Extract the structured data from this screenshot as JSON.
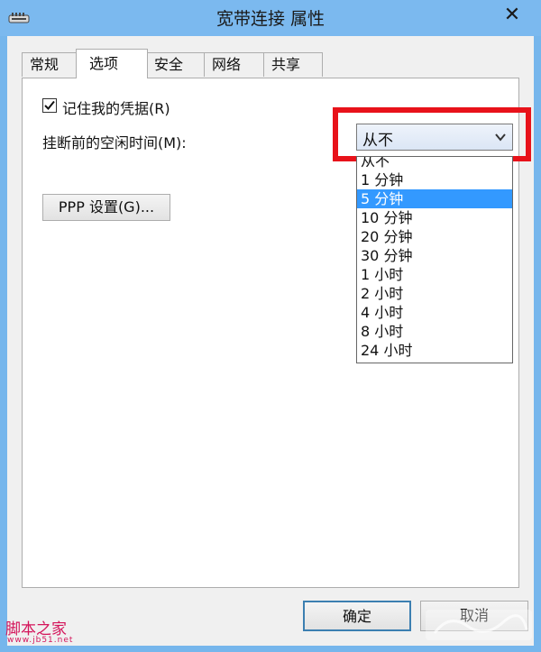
{
  "window": {
    "title": "宽带连接 属性",
    "close_glyph": "✕"
  },
  "tabs": [
    {
      "label": "常规",
      "active": false
    },
    {
      "label": "选项",
      "active": true
    },
    {
      "label": "安全",
      "active": false
    },
    {
      "label": "网络",
      "active": false
    },
    {
      "label": "共享",
      "active": false
    }
  ],
  "options": {
    "remember_credentials": {
      "label": "记住我的凭据(R)",
      "checked": true
    },
    "idle_time": {
      "label": "挂断前的空闲时间(M):",
      "selected_value": "从不",
      "options": [
        "从不",
        "1 分钟",
        "5 分钟",
        "10 分钟",
        "20 分钟",
        "30 分钟",
        "1 小时",
        "2 小时",
        "4 小时",
        "8 小时",
        "24 小时"
      ],
      "highlighted_index": 2
    },
    "ppp_button": "PPP 设置(G)..."
  },
  "footer": {
    "ok": "确定",
    "cancel": "取消"
  },
  "watermark": {
    "site_name": "脚本之家",
    "url": "www.jb51.net"
  },
  "colors": {
    "highlight_box": "#e8121a",
    "selection": "#3399ff",
    "window_frame": "#76b6ec"
  },
  "icons": {
    "app": "network-connection-icon",
    "close": "close-icon",
    "dropdown": "chevron-down-icon",
    "checkbox": "checkmark-icon"
  }
}
